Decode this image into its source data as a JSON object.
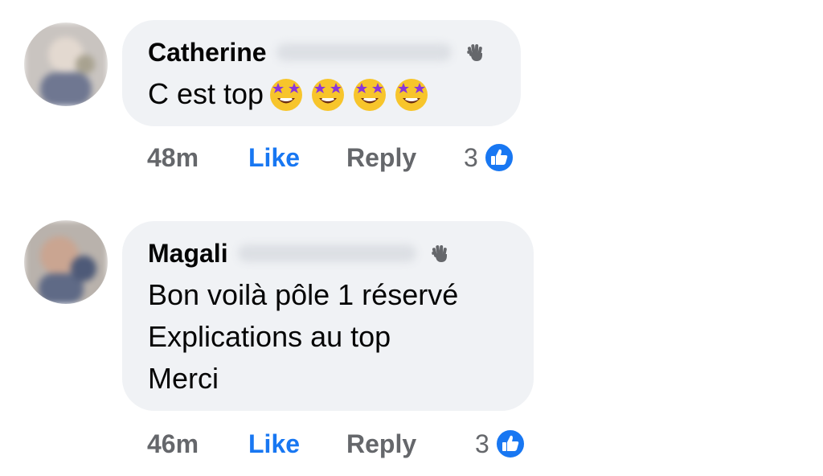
{
  "comments": [
    {
      "author": "Catherine",
      "text": "C est top",
      "emoji_name": "star-struck-emoji",
      "emoji_count": 4,
      "time": "48m",
      "like_label": "Like",
      "reply_label": "Reply",
      "reaction_count": "3",
      "reaction_icon": "like-icon"
    },
    {
      "author": "Magali",
      "text": "Bon voilà pôle 1 réservé\nExplications au top\nMerci",
      "time": "46m",
      "like_label": "Like",
      "reply_label": "Reply",
      "reaction_count": "3",
      "reaction_icon": "like-icon"
    }
  ],
  "colors": {
    "bubble": "#f0f2f5",
    "like_blue": "#1877f2",
    "secondary_text": "#65676b"
  }
}
